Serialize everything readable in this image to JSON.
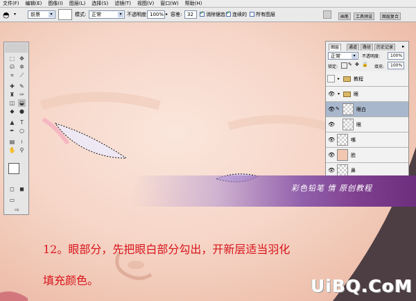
{
  "menubar": {
    "items": [
      "文件(F)",
      "编辑(E)",
      "图像(I)",
      "图层(L)",
      "选择(S)",
      "滤镜(T)",
      "视图(V)",
      "窗口(W)",
      "帮助(H)"
    ]
  },
  "options": {
    "fill_source": "前景",
    "mode_label": "模式:",
    "mode_value": "正常",
    "opacity_label": "不透明度:",
    "opacity_value": "100%",
    "tolerance_label": "容差:",
    "tolerance_value": "32",
    "antialias_label": "消除锯齿",
    "contiguous_label": "连续的",
    "all_layers_label": "所有图层",
    "well_tabs": [
      "画笔",
      "工具预设",
      "图层复合"
    ]
  },
  "layers_panel": {
    "tabs": [
      "图层",
      "通道",
      "路径",
      "历史记录"
    ],
    "blend_mode": "正常",
    "opacity_label": "不透明度:",
    "opacity_value": "100%",
    "lock_label": "锁定:",
    "fill_label": "填充:",
    "fill_value": "100%",
    "layers": [
      {
        "name": "教程",
        "type": "group",
        "expanded": false,
        "visible": false,
        "selected": false
      },
      {
        "name": "眼",
        "type": "group",
        "expanded": true,
        "visible": true,
        "selected": false
      },
      {
        "name": "眼白",
        "type": "layer",
        "visible": true,
        "selected": true
      },
      {
        "name": "眼",
        "type": "layer",
        "visible": true,
        "selected": false
      },
      {
        "name": "嘴",
        "type": "layer",
        "visible": true,
        "selected": false
      },
      {
        "name": "脸",
        "type": "layer",
        "visible": true,
        "selected": false
      },
      {
        "name": "鼻",
        "type": "layer",
        "visible": true,
        "selected": false
      }
    ]
  },
  "banner": {
    "text": "彩色铅笔 情 原创教程"
  },
  "caption": {
    "line1": "12。眼部分，先把眼白部分勾出，开新层适当羽化",
    "line2": "填充颜色。"
  },
  "watermark": "UiBQ.CoM",
  "colors": {
    "caption": "#d8141b",
    "selected_layer": "#a9b7cd",
    "banner": "#7f3f8f",
    "skin": "#f6d6c8"
  }
}
